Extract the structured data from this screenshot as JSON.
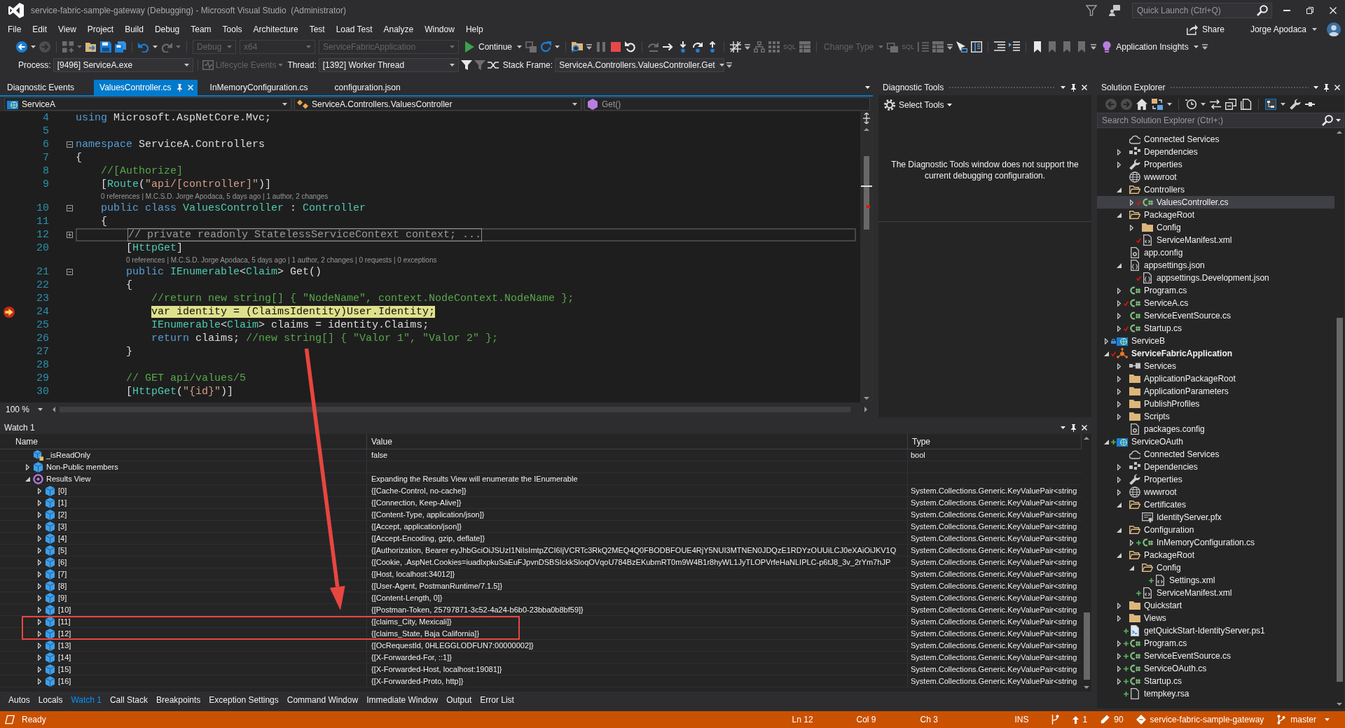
{
  "window": {
    "title": "service-fabric-sample-gateway (Debugging) - Microsoft Visual Studio  (Administrator)",
    "quick_launch": {
      "placeholder": "Quick Launch (Ctrl+Q)"
    },
    "share": "Share",
    "user": "Jorge Apodaca"
  },
  "menu": [
    "File",
    "Edit",
    "View",
    "Project",
    "Build",
    "Debug",
    "Team",
    "Tools",
    "Architecture",
    "Test",
    "Load Test",
    "Analyze",
    "Window",
    "Help"
  ],
  "toolbar": {
    "combos": [
      {
        "value": "Debug",
        "disabled": true
      },
      {
        "value": "x64",
        "disabled": true
      },
      {
        "value": "ServiceFabricApplication",
        "disabled": true
      }
    ],
    "buttons": [
      {
        "label": "Continue",
        "disabled": false
      },
      {
        "label": "Change Type",
        "disabled": true
      },
      {
        "label": "Application Insights",
        "disabled": false
      }
    ],
    "icon_labels": [
      "SQL",
      "SQL"
    ]
  },
  "debug_toolbar": {
    "process_label": "Process:",
    "process": "[9496] ServiceA.exe",
    "lifecycle": {
      "label": "Lifecycle Events",
      "disabled": true
    },
    "thread_label": "Thread:",
    "thread": "[1392] Worker Thread",
    "stack_frame_label": "Stack Frame:",
    "stack_frame": "ServiceA.Controllers.ValuesController.Get"
  },
  "document_tabs": [
    {
      "label": "Diagnostic Events",
      "selected": false
    },
    {
      "label": "ValuesController.cs",
      "selected": true
    },
    {
      "label": "InMemoryConfiguration.cs",
      "selected": false
    },
    {
      "label": "configuration.json",
      "selected": false
    }
  ],
  "editor": {
    "project": "ServiceA",
    "type": "ServiceA.Controllers.ValuesController",
    "member": "Get()",
    "zoom": "100 %",
    "lines": [
      {
        "kind": "code",
        "number": "4",
        "current": false,
        "caret": false,
        "code": [
          {
            "kind": "keyword",
            "text": "using"
          },
          {
            "kind": "plain",
            "text": " Microsoft.AspNetCore.Mvc;"
          }
        ]
      },
      {
        "kind": "code",
        "number": "5"
      },
      {
        "kind": "code",
        "number": "6",
        "folded": false,
        "current": false,
        "caret": false,
        "code": [
          {
            "kind": "keyword",
            "text": "namespace"
          },
          {
            "kind": "plain",
            "text": " ServiceA.Controllers"
          }
        ]
      },
      {
        "kind": "code",
        "number": "7",
        "current": false,
        "caret": false,
        "code": [
          {
            "kind": "plain",
            "text": "{"
          }
        ]
      },
      {
        "kind": "code",
        "number": "8",
        "current": false,
        "caret": false,
        "code": [
          {
            "kind": "comment",
            "text": "    //[Authorize]"
          }
        ]
      },
      {
        "kind": "code",
        "number": "9",
        "current": false,
        "caret": false,
        "code": [
          {
            "kind": "plain",
            "text": "    ["
          },
          {
            "kind": "type",
            "text": "Route"
          },
          {
            "kind": "plain",
            "text": "("
          },
          {
            "kind": "string",
            "text": "\"api/[controller]\""
          },
          {
            "kind": "plain",
            "text": ")]"
          }
        ]
      },
      {
        "kind": "lens",
        "text": "0 references | M.C.S.D. Jorge Apodaca, 5 days ago | 1 author, 2 changes"
      },
      {
        "kind": "code",
        "number": "10",
        "folded": false,
        "current": false,
        "caret": false,
        "code": [
          {
            "kind": "keyword",
            "text": "    public class"
          },
          {
            "kind": "type",
            "text": " ValuesController"
          },
          {
            "kind": "plain",
            "text": " : "
          },
          {
            "kind": "type",
            "text": "Controller"
          }
        ]
      },
      {
        "kind": "code",
        "number": "11",
        "current": false,
        "caret": false,
        "code": [
          {
            "kind": "plain",
            "text": "    {"
          }
        ]
      },
      {
        "kind": "code",
        "number": "12",
        "folded": true,
        "current": false,
        "caret": true,
        "code": [
          {
            "kind": "plain",
            "text": "        // private readonly StatelessServiceContext context; ..."
          }
        ]
      },
      {
        "kind": "code",
        "number": "20",
        "current": false,
        "caret": false,
        "code": [
          {
            "kind": "plain",
            "text": "        ["
          },
          {
            "kind": "type",
            "text": "HttpGet"
          },
          {
            "kind": "plain",
            "text": "]"
          }
        ]
      },
      {
        "kind": "lens",
        "text": "0 references | M.C.S.D. Jorge Apodaca, 5 days ago | 1 author, 2 changes | 0 requests | 0 exceptions"
      },
      {
        "kind": "code",
        "number": "21",
        "folded": false,
        "current": false,
        "caret": false,
        "code": [
          {
            "kind": "keyword",
            "text": "        public"
          },
          {
            "kind": "type",
            "text": " IEnumerable"
          },
          {
            "kind": "plain",
            "text": "<"
          },
          {
            "kind": "type",
            "text": "Claim"
          },
          {
            "kind": "plain",
            "text": "> Get()"
          }
        ]
      },
      {
        "kind": "code",
        "number": "22",
        "current": false,
        "caret": false,
        "code": [
          {
            "kind": "plain",
            "text": "        {"
          }
        ]
      },
      {
        "kind": "code",
        "number": "23",
        "current": false,
        "caret": false,
        "code": [
          {
            "kind": "comment",
            "text": "            //return new string[] { \"NodeName\", context.NodeContext.NodeName };"
          }
        ]
      },
      {
        "kind": "code",
        "number": "24",
        "current": true,
        "caret": false,
        "code": [
          {
            "kind": "keyword",
            "text": "            var"
          },
          {
            "kind": "plain",
            "text": " identity = (ClaimsIdentity)User.Identity;"
          }
        ]
      },
      {
        "kind": "code",
        "number": "25",
        "current": false,
        "caret": false,
        "code": [
          {
            "kind": "type",
            "text": "            IEnumerable"
          },
          {
            "kind": "plain",
            "text": "<"
          },
          {
            "kind": "type",
            "text": "Claim"
          },
          {
            "kind": "plain",
            "text": "> claims = identity.Claims;"
          }
        ]
      },
      {
        "kind": "code",
        "number": "26",
        "current": false,
        "caret": false,
        "code": [
          {
            "kind": "keyword",
            "text": "            return"
          },
          {
            "kind": "plain",
            "text": " claims; "
          },
          {
            "kind": "comment",
            "text": "//new string[] { \"Valor 1\", \"Valor 2\" };"
          }
        ]
      },
      {
        "kind": "code",
        "number": "27",
        "current": false,
        "caret": false,
        "code": [
          {
            "kind": "plain",
            "text": "        }"
          }
        ]
      },
      {
        "kind": "code",
        "number": "28"
      },
      {
        "kind": "code",
        "number": "29",
        "current": false,
        "caret": false,
        "code": [
          {
            "kind": "comment",
            "text": "        // GET api/values/5"
          }
        ]
      },
      {
        "kind": "code",
        "number": "30",
        "current": false,
        "caret": false,
        "code": [
          {
            "kind": "plain",
            "text": "        ["
          },
          {
            "kind": "type",
            "text": "HttpGet"
          },
          {
            "kind": "plain",
            "text": "("
          },
          {
            "kind": "string",
            "text": "\"{id}\""
          },
          {
            "kind": "plain",
            "text": ")]"
          }
        ]
      }
    ]
  },
  "diagnostic_tools": {
    "title": "Diagnostic Tools",
    "select_tools": "Select Tools",
    "message": "The Diagnostic Tools window does not support the current debugging configuration."
  },
  "solution_explorer": {
    "title": "Solution Explorer",
    "toggle_button": {
      "on": true
    },
    "search": {
      "placeholder": "Search Solution Explorer (Ctrl+;)"
    },
    "tree": {
      "continued": [
        {
          "label": "Connected Services",
          "kind": "cloud",
          "selected": false
        },
        {
          "label": "Dependencies",
          "kind": "deps",
          "expanded": false,
          "selected": false
        },
        {
          "label": "Properties",
          "kind": "wrench",
          "expanded": false,
          "selected": false
        },
        {
          "label": "wwwroot",
          "kind": "globe",
          "selected": false
        },
        {
          "label": "Controllers",
          "kind": "folder",
          "expanded": true,
          "selected": false,
          "children": [
            {
              "label": "ValuesController.cs",
              "kind": "cs",
              "expanded": false,
              "selected": true,
              "edited": true
            }
          ]
        },
        {
          "label": "PackageRoot",
          "kind": "folder",
          "expanded": true,
          "selected": false,
          "children": [
            {
              "label": "Config",
              "kind": "folder",
              "expanded": false,
              "selected": false
            },
            {
              "label": "ServiceManifest.xml",
              "kind": "xml",
              "selected": false,
              "edited": true
            }
          ]
        },
        {
          "label": "app.config",
          "kind": "config",
          "selected": false
        },
        {
          "label": "appsettings.json",
          "kind": "json",
          "expanded": true,
          "selected": false,
          "children": [
            {
              "label": "appsettings.Development.json",
              "kind": "json",
              "selected": false,
              "edited": true
            }
          ]
        },
        {
          "label": "Program.cs",
          "kind": "cs",
          "expanded": false,
          "selected": false
        },
        {
          "label": "ServiceA.cs",
          "kind": "cs",
          "expanded": false,
          "selected": false,
          "edited": true
        },
        {
          "label": "ServiceEventSource.cs",
          "kind": "cs",
          "expanded": false,
          "selected": false
        },
        {
          "label": "Startup.cs",
          "kind": "cs",
          "expanded": false,
          "selected": false,
          "edited": true
        }
      ],
      "projects": [
        {
          "label": "ServiceB",
          "kind": "webproject",
          "expanded": false,
          "selected": false,
          "startup": false,
          "locked": true
        },
        {
          "label": "ServiceFabricApplication",
          "kind": "sfapp",
          "expanded": true,
          "selected": false,
          "startup": true,
          "edited": true,
          "children": [
            {
              "label": "Services",
              "kind": "services",
              "expanded": false,
              "selected": false
            },
            {
              "label": "ApplicationPackageRoot",
              "kind": "folder",
              "expanded": false,
              "selected": false
            },
            {
              "label": "ApplicationParameters",
              "kind": "folder",
              "expanded": false,
              "selected": false
            },
            {
              "label": "PublishProfiles",
              "kind": "folder",
              "expanded": false,
              "selected": false
            },
            {
              "label": "Scripts",
              "kind": "folder",
              "expanded": false,
              "selected": false
            },
            {
              "label": "packages.config",
              "kind": "config",
              "selected": false
            }
          ]
        },
        {
          "label": "ServiceOAuth",
          "kind": "webproject",
          "expanded": true,
          "selected": false,
          "startup": false,
          "added": true,
          "children": [
            {
              "label": "Connected Services",
              "kind": "cloud",
              "selected": false
            },
            {
              "label": "Dependencies",
              "kind": "deps",
              "expanded": false,
              "selected": false
            },
            {
              "label": "Properties",
              "kind": "wrench",
              "expanded": false,
              "selected": false
            },
            {
              "label": "wwwroot",
              "kind": "globe",
              "expanded": false,
              "selected": false
            },
            {
              "label": "Certificates",
              "kind": "folder",
              "expanded": true,
              "selected": false,
              "children": [
                {
                  "label": "IdentityServer.pfx",
                  "kind": "cert",
                  "selected": false
                }
              ]
            },
            {
              "label": "Configuration",
              "kind": "folder",
              "expanded": true,
              "selected": false,
              "children": [
                {
                  "label": "InMemoryConfiguration.cs",
                  "kind": "cs",
                  "expanded": false,
                  "selected": false,
                  "added": true
                }
              ]
            },
            {
              "label": "PackageRoot",
              "kind": "folder",
              "expanded": true,
              "selected": false,
              "children": [
                {
                  "label": "Config",
                  "kind": "folder",
                  "expanded": true,
                  "selected": false,
                  "children": [
                    {
                      "label": "Settings.xml",
                      "kind": "xml",
                      "selected": false,
                      "added": true
                    }
                  ]
                },
                {
                  "label": "ServiceManifest.xml",
                  "kind": "xml",
                  "selected": false,
                  "added": true
                }
              ]
            },
            {
              "label": "Quickstart",
              "kind": "folder",
              "expanded": false,
              "selected": false
            },
            {
              "label": "Views",
              "kind": "folder",
              "expanded": false,
              "selected": false
            },
            {
              "label": "getQuickStart-IdentityServer.ps1",
              "kind": "script",
              "selected": false,
              "added": true
            },
            {
              "label": "Program.cs",
              "kind": "cs",
              "expanded": false,
              "selected": false,
              "added": true
            },
            {
              "label": "ServiceEventSource.cs",
              "kind": "cs",
              "expanded": false,
              "selected": false,
              "added": true
            },
            {
              "label": "ServiceOAuth.cs",
              "kind": "cs",
              "expanded": false,
              "selected": false,
              "added": true
            },
            {
              "label": "Startup.cs",
              "kind": "cs",
              "expanded": false,
              "selected": false,
              "added": true
            },
            {
              "label": "tempkey.rsa",
              "kind": "file",
              "selected": false,
              "added": true
            }
          ]
        }
      ]
    }
  },
  "watch": {
    "title": "Watch 1",
    "columns": [
      "Name",
      "Value",
      "Type"
    ],
    "rows": [
      {
        "name": "_isReadOnly",
        "value": "false",
        "type": "bool",
        "kind": "field"
      },
      {
        "name": "Non-Public members",
        "kind": "group",
        "expanded": false
      },
      {
        "name": "Results View",
        "value": "Expanding the Results View will enumerate the IEnumerable",
        "kind": "results",
        "expanded": true,
        "children": [
          {
            "name": "[0]",
            "value": "{[Cache-Control, no-cache]}",
            "type": "System.Collections.Generic.KeyValuePair<string",
            "kind": "item",
            "expanded": false
          },
          {
            "name": "[1]",
            "value": "{[Connection, Keep-Alive]}",
            "type": "System.Collections.Generic.KeyValuePair<string",
            "kind": "item",
            "expanded": false
          },
          {
            "name": "[2]",
            "value": "{[Content-Type, application/json]}",
            "type": "System.Collections.Generic.KeyValuePair<string",
            "kind": "item",
            "expanded": false
          },
          {
            "name": "[3]",
            "value": "{[Accept, application/json]}",
            "type": "System.Collections.Generic.KeyValuePair<string",
            "kind": "item",
            "expanded": false
          },
          {
            "name": "[4]",
            "value": "{[Accept-Encoding, gzip, deflate]}",
            "type": "System.Collections.Generic.KeyValuePair<string",
            "kind": "item",
            "expanded": false
          },
          {
            "name": "[5]",
            "value": "{[Authorization, Bearer eyJhbGciOiJSUzI1NiIsImtpZCI6IjVCRTc3RkQ2MEQ4Q0FBODBFOUE4RjY5NUI3MTNEN0JDQzE1RDYzOUUiLCJ0eXAiOiJKV1Q",
            "type": "System.Collections.Generic.KeyValuePair<string",
            "kind": "item",
            "expanded": false
          },
          {
            "name": "[6]",
            "value": "{[Cookie, .AspNet.Cookies=iuadlxpkuSaEuFJpvnDSBSIckkSloqOVqoU784BzEKubmRT0m9W4B1r8hyWL1JyTLOPVrfeHaNLIPLC-p6tJ8_3v_2rYm7hJP",
            "type": "System.Collections.Generic.KeyValuePair<string",
            "kind": "item",
            "expanded": false
          },
          {
            "name": "[7]",
            "value": "{[Host, localhost:34012]}",
            "type": "System.Collections.Generic.KeyValuePair<string",
            "kind": "item",
            "expanded": false
          },
          {
            "name": "[8]",
            "value": "{[User-Agent, PostmanRuntime/7.1.5]}",
            "type": "System.Collections.Generic.KeyValuePair<string",
            "kind": "item",
            "expanded": false
          },
          {
            "name": "[9]",
            "value": "{[Content-Length, 0]}",
            "type": "System.Collections.Generic.KeyValuePair<string",
            "kind": "item",
            "expanded": false
          },
          {
            "name": "[10]",
            "value": "{[Postman-Token, 25797871-3c52-4a24-b6b0-23bba0b8bf59]}",
            "type": "System.Collections.Generic.KeyValuePair<string",
            "kind": "item",
            "expanded": false
          },
          {
            "name": "[11]",
            "value": "{[claims_City, Mexicali]}",
            "type": "System.Collections.Generic.KeyValuePair<string",
            "kind": "item",
            "expanded": false,
            "highlighted": true
          },
          {
            "name": "[12]",
            "value": "{[claims_State, Baja California]}",
            "type": "System.Collections.Generic.KeyValuePair<string",
            "kind": "item",
            "expanded": false,
            "highlighted": true
          },
          {
            "name": "[13]",
            "value": "{[OcRequestId, 0HLEGGLODFUN7:00000002]}",
            "type": "System.Collections.Generic.KeyValuePair<string",
            "kind": "item",
            "expanded": false
          },
          {
            "name": "[14]",
            "value": "{[X-Forwarded-For, ::1]}",
            "type": "System.Collections.Generic.KeyValuePair<string",
            "kind": "item",
            "expanded": false
          },
          {
            "name": "[15]",
            "value": "{[X-Forwarded-Host, localhost:19081]}",
            "type": "System.Collections.Generic.KeyValuePair<string",
            "kind": "item",
            "expanded": false
          },
          {
            "name": "[16]",
            "value": "{[X-Forwarded-Proto, http]}",
            "type": "System.Collections.Generic.KeyValuePair<string",
            "kind": "item",
            "expanded": false
          }
        ]
      }
    ]
  },
  "tool_tabs": [
    {
      "label": "Autos",
      "selected": false
    },
    {
      "label": "Locals",
      "selected": false
    },
    {
      "label": "Watch 1",
      "selected": true
    },
    {
      "label": "Call Stack",
      "selected": false
    },
    {
      "label": "Breakpoints",
      "selected": false
    },
    {
      "label": "Exception Settings",
      "selected": false
    },
    {
      "label": "Command Window",
      "selected": false
    },
    {
      "label": "Immediate Window",
      "selected": false
    },
    {
      "label": "Output",
      "selected": false
    },
    {
      "label": "Error List",
      "selected": false
    }
  ],
  "status_bar": {
    "state": "Ready",
    "line": "Ln 12",
    "column": "Col 9",
    "char": "Ch 3",
    "mode": "INS",
    "unpushed": "1",
    "changes": "90",
    "repo": "service-fabric-sample-gateway",
    "branch": "master"
  }
}
